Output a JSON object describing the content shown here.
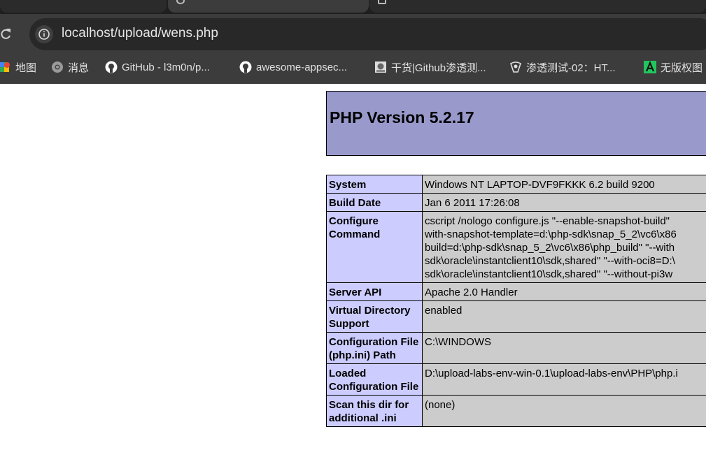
{
  "browser": {
    "address_bar": {
      "url": "localhost/upload/wens.php"
    },
    "bookmarks": [
      {
        "label": "地图",
        "icon": "maps-icon"
      },
      {
        "label": "消息",
        "icon": "chrome-icon"
      },
      {
        "label": "GitHub - l3m0n/p...",
        "icon": "github-icon"
      },
      {
        "label": "awesome-appsec...",
        "icon": "github-icon"
      },
      {
        "label": "干货|Github渗透测...",
        "icon": "page-icon"
      },
      {
        "label": "渗透测试-02：HT...",
        "icon": "site-icon"
      },
      {
        "label": "无版权图",
        "icon": "a-logo-icon"
      }
    ]
  },
  "phpinfo": {
    "title": "PHP Version 5.2.17",
    "rows": [
      {
        "key": "System",
        "value": [
          "Windows NT LAPTOP-DVF9FKKK 6.2 build 9200"
        ]
      },
      {
        "key": "Build Date",
        "value": [
          "Jan 6 2011 17:26:08"
        ]
      },
      {
        "key": "Configure Command",
        "value": [
          "cscript /nologo configure.js \"--enable-snapshot-build\"",
          "with-snapshot-template=d:\\php-sdk\\snap_5_2\\vc6\\x86",
          "build=d:\\php-sdk\\snap_5_2\\vc6\\x86\\php_build\" \"--with",
          "sdk\\oracle\\instantclient10\\sdk,shared\" \"--with-oci8=D:\\",
          "sdk\\oracle\\instantclient10\\sdk,shared\" \"--without-pi3w"
        ]
      },
      {
        "key": "Server API",
        "value": [
          "Apache 2.0 Handler"
        ]
      },
      {
        "key": "Virtual Directory Support",
        "value": [
          "enabled"
        ]
      },
      {
        "key": "Configuration File (php.ini) Path",
        "value": [
          "C:\\WINDOWS"
        ]
      },
      {
        "key": "Loaded Configuration File",
        "value": [
          "D:\\upload-labs-env-win-0.1\\upload-labs-env\\PHP\\php.i"
        ]
      },
      {
        "key": "Scan this dir for additional .ini",
        "value": [
          "(none)"
        ]
      }
    ]
  }
}
